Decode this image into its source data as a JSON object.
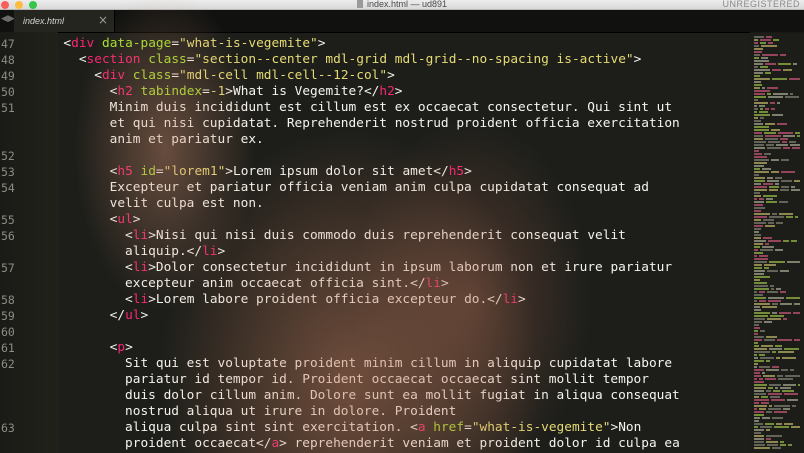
{
  "window": {
    "title": "index.html — ud891",
    "license_status": "UNREGISTERED"
  },
  "tab": {
    "label": "index.html",
    "close_symbol": "×",
    "nav_symbol": "◀▶"
  },
  "code_lines": [
    {
      "num": "47",
      "indent": "  ",
      "tokens": [
        [
          "p",
          "<"
        ],
        [
          "tg",
          "div"
        ],
        [
          "p",
          " "
        ],
        [
          "at",
          "data-page"
        ],
        [
          "p",
          "="
        ],
        [
          "st",
          "\"what-is-vegemite\""
        ],
        [
          "p",
          ">"
        ]
      ]
    },
    {
      "num": "48",
      "indent": "    ",
      "tokens": [
        [
          "p",
          "<"
        ],
        [
          "tg",
          "section"
        ],
        [
          "p",
          " "
        ],
        [
          "at",
          "class"
        ],
        [
          "p",
          "="
        ],
        [
          "st",
          "\"section--center mdl-grid mdl-grid--no-spacing is-active\""
        ],
        [
          "p",
          ">"
        ]
      ]
    },
    {
      "num": "49",
      "indent": "      ",
      "tokens": [
        [
          "p",
          "<"
        ],
        [
          "tg",
          "div"
        ],
        [
          "p",
          " "
        ],
        [
          "at",
          "class"
        ],
        [
          "p",
          "="
        ],
        [
          "st",
          "\"mdl-cell mdl-cell--12-col\""
        ],
        [
          "p",
          ">"
        ]
      ]
    },
    {
      "num": "50",
      "indent": "        ",
      "tokens": [
        [
          "p",
          "<"
        ],
        [
          "tg",
          "h2"
        ],
        [
          "p",
          " "
        ],
        [
          "at",
          "tabindex"
        ],
        [
          "p",
          "="
        ],
        [
          "st",
          "-1"
        ],
        [
          "p",
          ">What is Vegemite?</"
        ],
        [
          "tg",
          "h2"
        ],
        [
          "p",
          ">"
        ]
      ]
    },
    {
      "num": "51",
      "indent": "        ",
      "tokens": [
        [
          "p",
          "Minim duis incididunt est cillum est ex occaecat consectetur. Qui sint ut"
        ]
      ]
    },
    {
      "num": "",
      "indent": "        ",
      "tokens": [
        [
          "p",
          "et qui nisi cupidatat. Reprehenderit nostrud proident officia exercitation"
        ]
      ]
    },
    {
      "num": "",
      "indent": "        ",
      "tokens": [
        [
          "p",
          "anim et pariatur ex."
        ]
      ]
    },
    {
      "num": "52",
      "indent": "",
      "tokens": []
    },
    {
      "num": "53",
      "indent": "        ",
      "tokens": [
        [
          "p",
          "<"
        ],
        [
          "tg",
          "h5"
        ],
        [
          "p",
          " "
        ],
        [
          "at",
          "id"
        ],
        [
          "p",
          "="
        ],
        [
          "st",
          "\"lorem1\""
        ],
        [
          "p",
          ">Lorem ipsum dolor sit amet</"
        ],
        [
          "tg",
          "h5"
        ],
        [
          "p",
          ">"
        ]
      ]
    },
    {
      "num": "54",
      "indent": "        ",
      "tokens": [
        [
          "p",
          "Excepteur et pariatur officia veniam anim culpa cupidatat consequat ad"
        ]
      ]
    },
    {
      "num": "",
      "indent": "        ",
      "tokens": [
        [
          "p",
          "velit culpa est non."
        ]
      ]
    },
    {
      "num": "55",
      "indent": "        ",
      "tokens": [
        [
          "p",
          "<"
        ],
        [
          "tg",
          "ul"
        ],
        [
          "p",
          ">"
        ]
      ]
    },
    {
      "num": "56",
      "indent": "          ",
      "tokens": [
        [
          "p",
          "<"
        ],
        [
          "tg",
          "li"
        ],
        [
          "p",
          ">Nisi qui nisi duis commodo duis reprehenderit consequat velit"
        ]
      ]
    },
    {
      "num": "",
      "indent": "          ",
      "tokens": [
        [
          "p",
          "aliquip.</"
        ],
        [
          "tg",
          "li"
        ],
        [
          "p",
          ">"
        ]
      ]
    },
    {
      "num": "57",
      "indent": "          ",
      "tokens": [
        [
          "p",
          "<"
        ],
        [
          "tg",
          "li"
        ],
        [
          "p",
          ">Dolor consectetur incididunt in ipsum laborum non et irure pariatur"
        ]
      ]
    },
    {
      "num": "",
      "indent": "          ",
      "tokens": [
        [
          "p",
          "excepteur anim occaecat officia sint.</"
        ],
        [
          "tg",
          "li"
        ],
        [
          "p",
          ">"
        ]
      ]
    },
    {
      "num": "58",
      "indent": "          ",
      "tokens": [
        [
          "p",
          "<"
        ],
        [
          "tg",
          "li"
        ],
        [
          "p",
          ">Lorem labore proident officia excepteur do.</"
        ],
        [
          "tg",
          "li"
        ],
        [
          "p",
          ">"
        ]
      ]
    },
    {
      "num": "59",
      "indent": "        ",
      "tokens": [
        [
          "p",
          "</"
        ],
        [
          "tg",
          "ul"
        ],
        [
          "p",
          ">"
        ]
      ]
    },
    {
      "num": "60",
      "indent": "",
      "tokens": []
    },
    {
      "num": "61",
      "indent": "        ",
      "tokens": [
        [
          "p",
          "<"
        ],
        [
          "tg",
          "p"
        ],
        [
          "p",
          ">"
        ]
      ]
    },
    {
      "num": "62",
      "indent": "          ",
      "tokens": [
        [
          "p",
          "Sit qui est voluptate proident minim cillum in aliquip cupidatat labore"
        ]
      ]
    },
    {
      "num": "",
      "indent": "          ",
      "tokens": [
        [
          "p",
          "pariatur id tempor id. Proident occaecat occaecat sint mollit tempor"
        ]
      ]
    },
    {
      "num": "",
      "indent": "          ",
      "tokens": [
        [
          "p",
          "duis dolor cillum anim. Dolore sunt ea mollit fugiat in aliqua consequat"
        ]
      ]
    },
    {
      "num": "",
      "indent": "          ",
      "tokens": [
        [
          "p",
          "nostrud aliqua ut irure in dolore. Proident"
        ]
      ]
    },
    {
      "num": "63",
      "indent": "          ",
      "tokens": [
        [
          "p",
          "aliqua culpa sint sint exercitation. <"
        ],
        [
          "tg",
          "a"
        ],
        [
          "p",
          " "
        ],
        [
          "at",
          "href"
        ],
        [
          "p",
          "="
        ],
        [
          "st",
          "\"what-is-vegemite\""
        ],
        [
          "p",
          ">Non"
        ]
      ]
    },
    {
      "num": "",
      "indent": "          ",
      "tokens": [
        [
          "p",
          "proident occaecat</"
        ],
        [
          "tg",
          "a"
        ],
        [
          "p",
          "> reprehenderit veniam et proident dolor id culpa ea"
        ]
      ]
    }
  ],
  "colors": {
    "background": "#1d1e1a",
    "text": "#f5f5ef",
    "tag": "#f92672",
    "attribute": "#a6e22e",
    "string": "#e6db74",
    "line_number": "#8c8c80"
  }
}
